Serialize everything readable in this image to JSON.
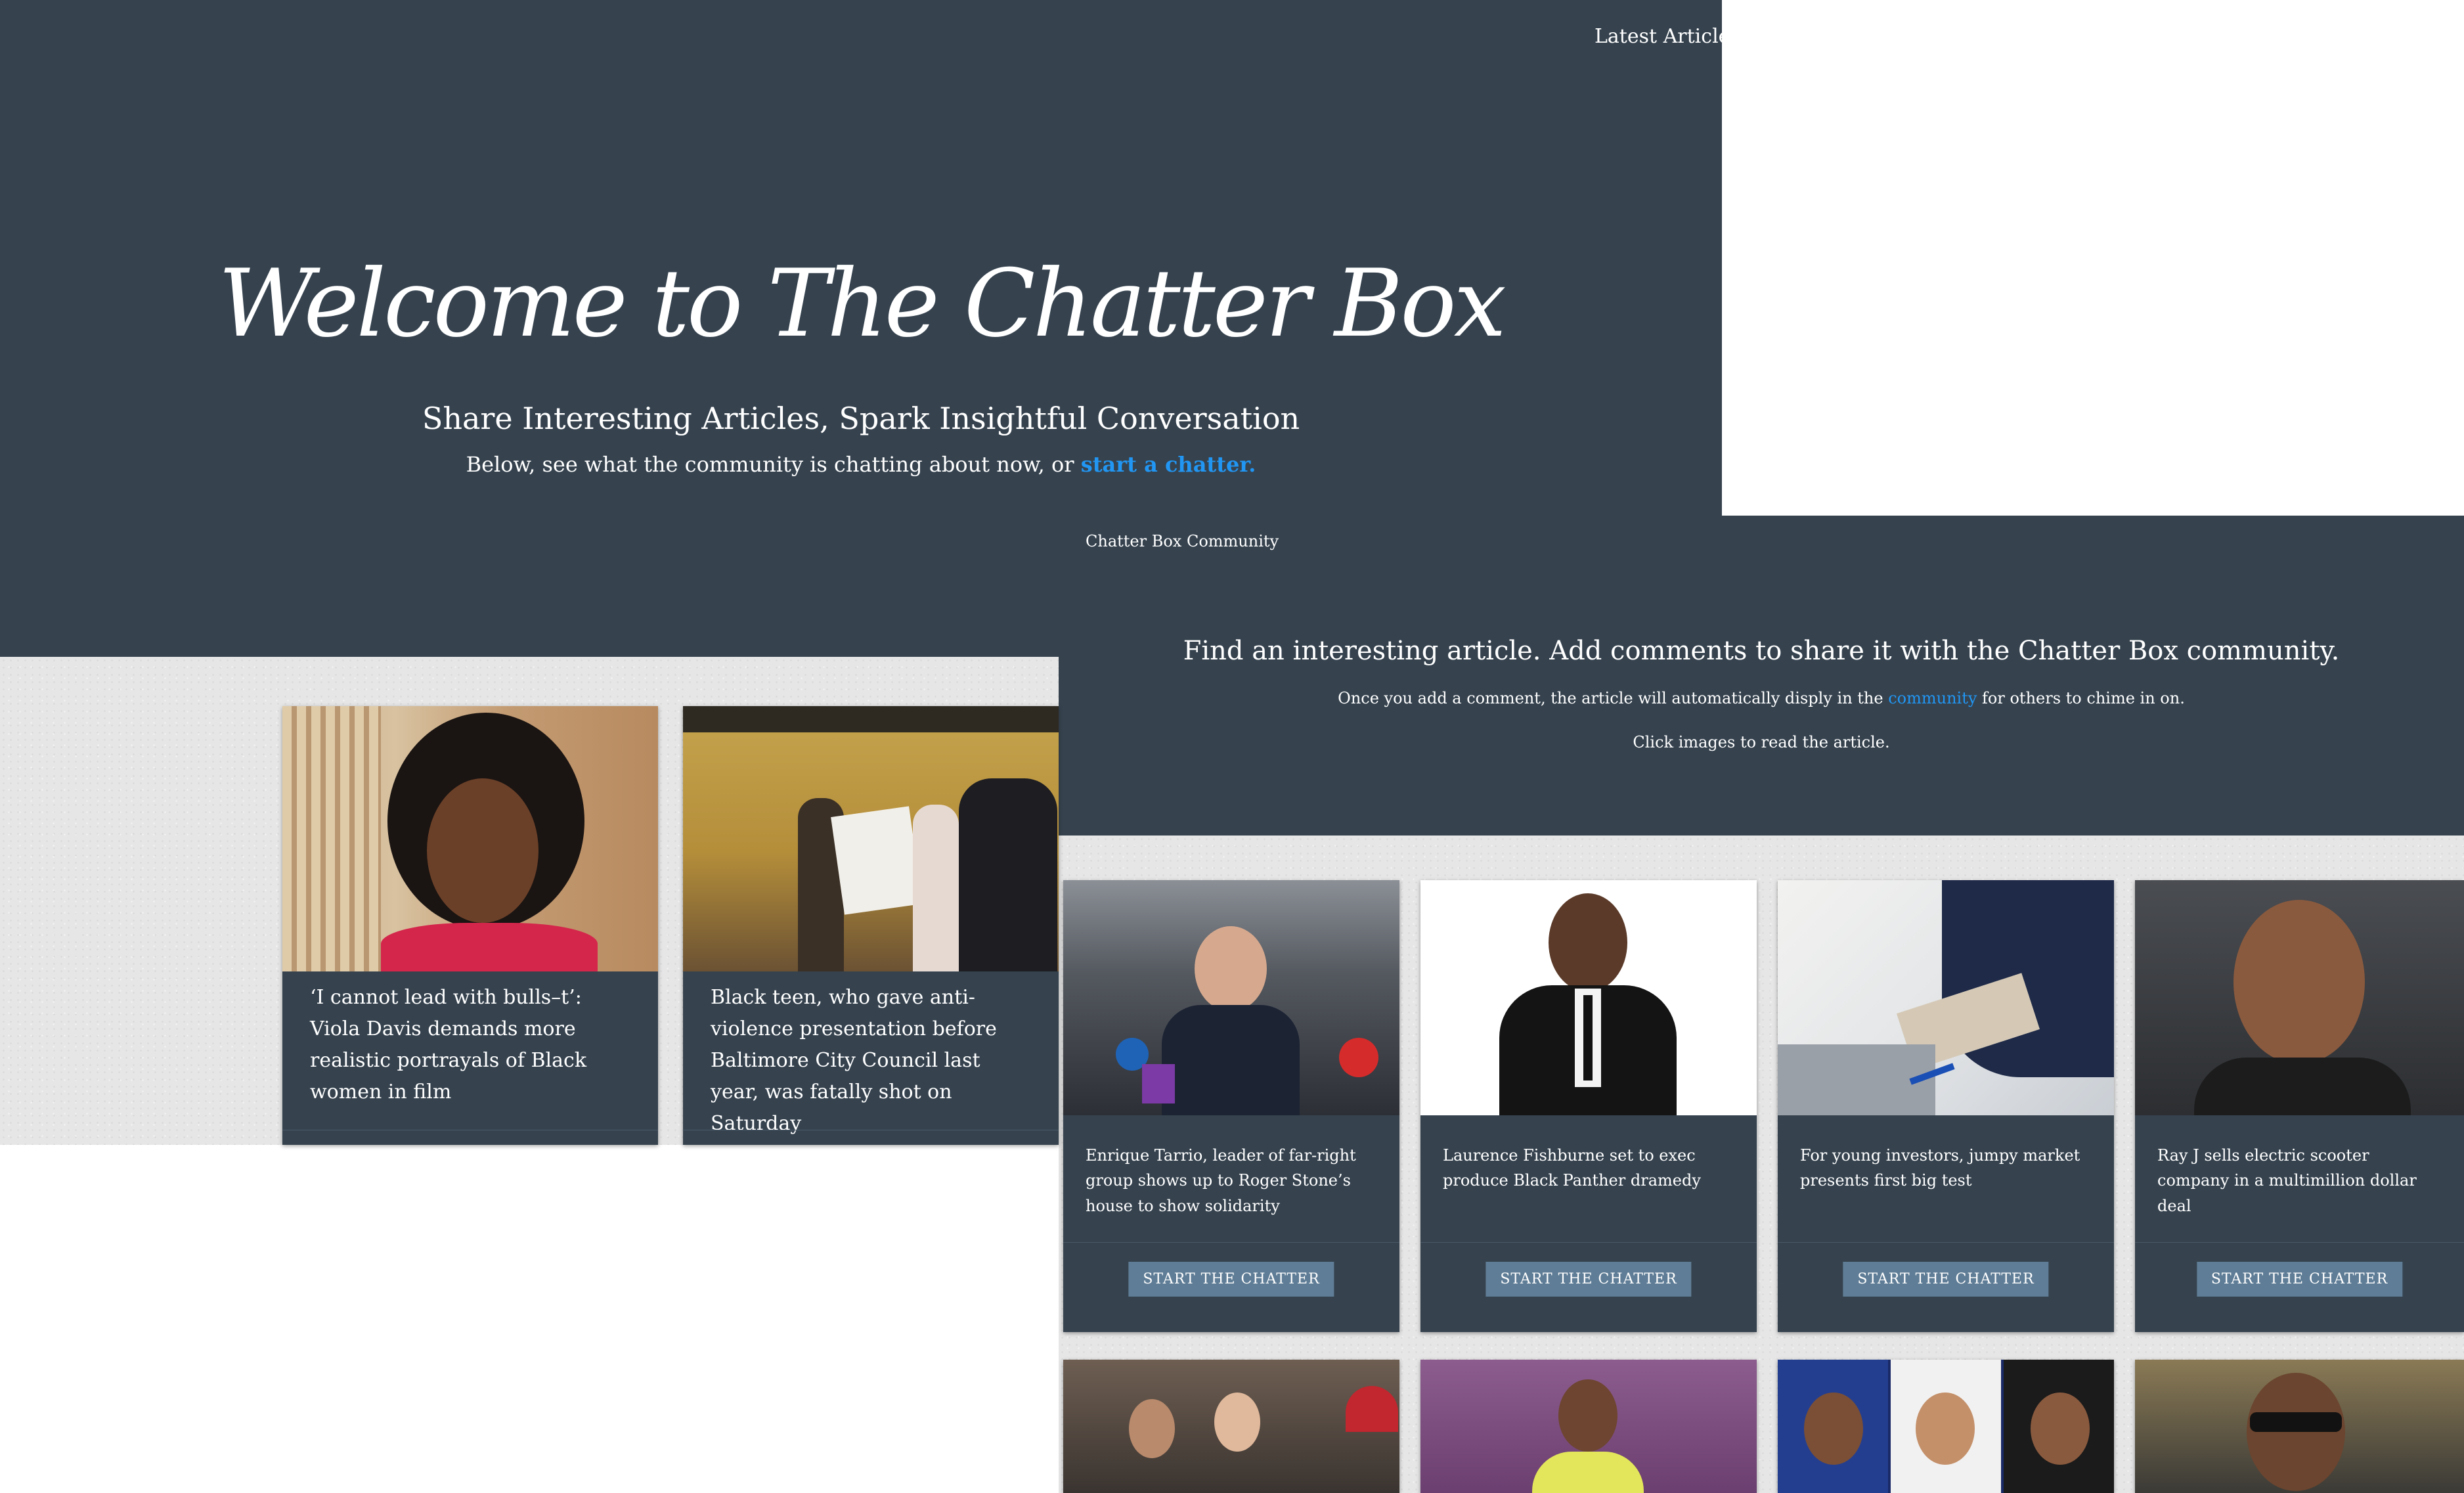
{
  "nav": {
    "latest_articles": "Latest Articles"
  },
  "hero": {
    "title": "Welcome to The Chatter Box",
    "subtitle": "Share Interesting Articles, Spark Insightful Conversation",
    "line_prefix": "Below, see what the community is chatting about now, or ",
    "line_link": "start a chatter."
  },
  "community_label": "Chatter Box Community",
  "find": {
    "title": "Find an interesting article. Add comments to share it with the Chatter Box community.",
    "line1_prefix": "Once you add a comment, the article will automatically disply in the ",
    "line1_link": "community",
    "line1_suffix": " for others to chime in on.",
    "line2": "Click images to read the article."
  },
  "community_cards": [
    {
      "caption": "‘I cannot lead with bulls–t’: Viola Davis demands more realistic portrayals of Black women in film"
    },
    {
      "caption": "Black teen, who gave anti-violence presentation before Baltimore City Council last year, was fatally shot on Saturday"
    }
  ],
  "latest_cards": [
    {
      "caption": "Enrique Tarrio, leader of far-right group shows up to Roger Stone’s house to show solidarity",
      "button": "START THE CHATTER"
    },
    {
      "caption": "Laurence Fishburne set to exec produce Black Panther dramedy",
      "button": "START THE CHATTER"
    },
    {
      "caption": "For young investors, jumpy market presents first big test",
      "button": "START THE CHATTER"
    },
    {
      "caption": "Ray J sells electric scooter company in a multimillion dollar deal",
      "button": "START THE CHATTER"
    }
  ],
  "colors": {
    "slate": "#36434f",
    "button": "#5f7d96",
    "link": "#2196f3"
  }
}
